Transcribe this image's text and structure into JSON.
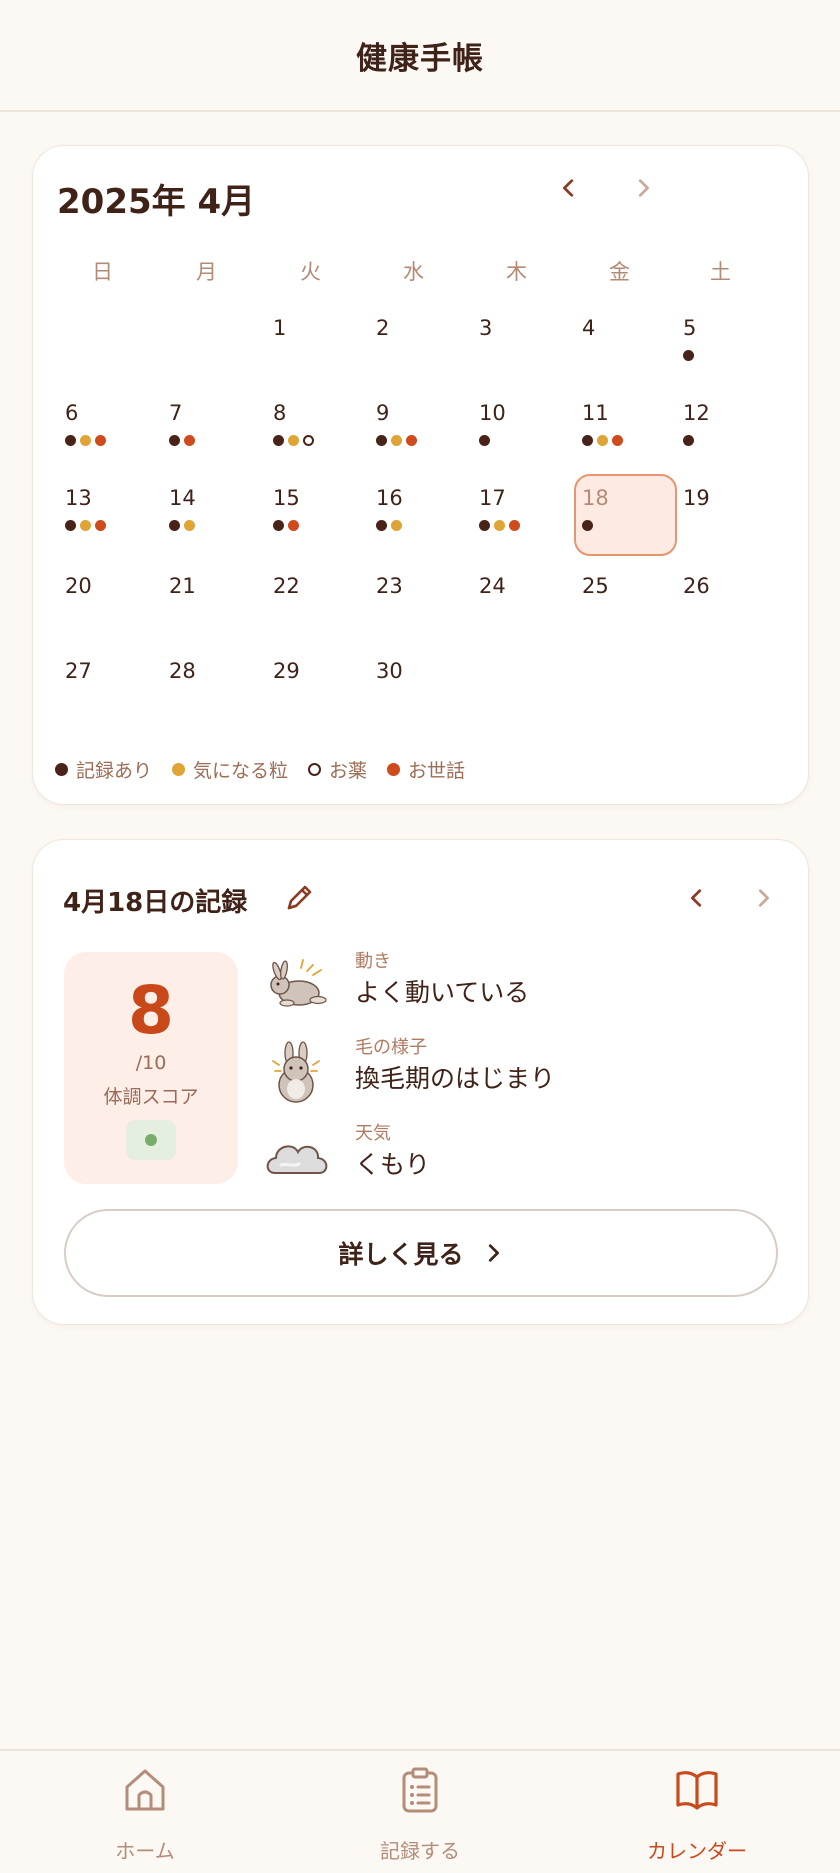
{
  "header": {
    "title": "健康手帳"
  },
  "calendar": {
    "month_title": "2025年 4月",
    "prev_icon": "chevron-left-icon",
    "next_icon": "chevron-right-icon",
    "weekdays": [
      "日",
      "月",
      "火",
      "水",
      "木",
      "金",
      "土"
    ],
    "first_weekday_index": 2,
    "selected_day": 18,
    "days": [
      {
        "label": "1",
        "dots": []
      },
      {
        "label": "2",
        "dots": []
      },
      {
        "label": "3",
        "dots": []
      },
      {
        "label": "4",
        "dots": []
      },
      {
        "label": "5",
        "dots": [
          "record"
        ]
      },
      {
        "label": "6",
        "dots": [
          "record",
          "concern",
          "care"
        ]
      },
      {
        "label": "7",
        "dots": [
          "record",
          "care"
        ]
      },
      {
        "label": "8",
        "dots": [
          "record",
          "concern",
          "medicine"
        ]
      },
      {
        "label": "9",
        "dots": [
          "record",
          "concern",
          "care"
        ]
      },
      {
        "label": "10",
        "dots": [
          "record"
        ]
      },
      {
        "label": "11",
        "dots": [
          "record",
          "concern",
          "care"
        ]
      },
      {
        "label": "12",
        "dots": [
          "record"
        ]
      },
      {
        "label": "13",
        "dots": [
          "record",
          "concern",
          "care"
        ]
      },
      {
        "label": "14",
        "dots": [
          "record",
          "concern"
        ]
      },
      {
        "label": "15",
        "dots": [
          "record",
          "care"
        ]
      },
      {
        "label": "16",
        "dots": [
          "record",
          "concern"
        ]
      },
      {
        "label": "17",
        "dots": [
          "record",
          "concern",
          "care"
        ]
      },
      {
        "label": "18",
        "dots": [
          "record"
        ]
      },
      {
        "label": "19",
        "dots": []
      },
      {
        "label": "20",
        "dots": []
      },
      {
        "label": "21",
        "dots": []
      },
      {
        "label": "22",
        "dots": []
      },
      {
        "label": "23",
        "dots": []
      },
      {
        "label": "24",
        "dots": []
      },
      {
        "label": "25",
        "dots": []
      },
      {
        "label": "26",
        "dots": []
      },
      {
        "label": "27",
        "dots": []
      },
      {
        "label": "28",
        "dots": []
      },
      {
        "label": "29",
        "dots": []
      },
      {
        "label": "30",
        "dots": []
      }
    ],
    "legend": [
      {
        "key": "record",
        "label": "記録あり",
        "color": "#4a2318"
      },
      {
        "key": "concern",
        "label": "気になる粒",
        "color": "#e0a336"
      },
      {
        "key": "medicine",
        "label": "お薬",
        "color": "#4a2318"
      },
      {
        "key": "care",
        "label": "お世話",
        "color": "#cf4a1c"
      }
    ]
  },
  "record": {
    "title": "4月18日の記録",
    "edit_icon": "pencil-icon",
    "score": {
      "value": "8",
      "max": "/10",
      "label": "体調スコア",
      "status_color": "#78ad6b"
    },
    "items": [
      {
        "label": "動き",
        "value": "よく動いている",
        "icon": "jumping-rabbit-icon"
      },
      {
        "label": "毛の様子",
        "value": "換毛期のはじまり",
        "icon": "fluffy-rabbit-icon"
      },
      {
        "label": "天気",
        "value": "くもり",
        "icon": "cloud-icon"
      }
    ],
    "detail_button": "詳しく見る"
  },
  "bottom_nav": [
    {
      "label": "ホーム",
      "icon": "home-icon",
      "active": false
    },
    {
      "label": "記録する",
      "icon": "clipboard-icon",
      "active": false
    },
    {
      "label": "カレンダー",
      "icon": "book-icon",
      "active": true
    }
  ],
  "colors": {
    "accent": "#c8481a",
    "text": "#3f2218",
    "background": "#fcf8f3"
  }
}
